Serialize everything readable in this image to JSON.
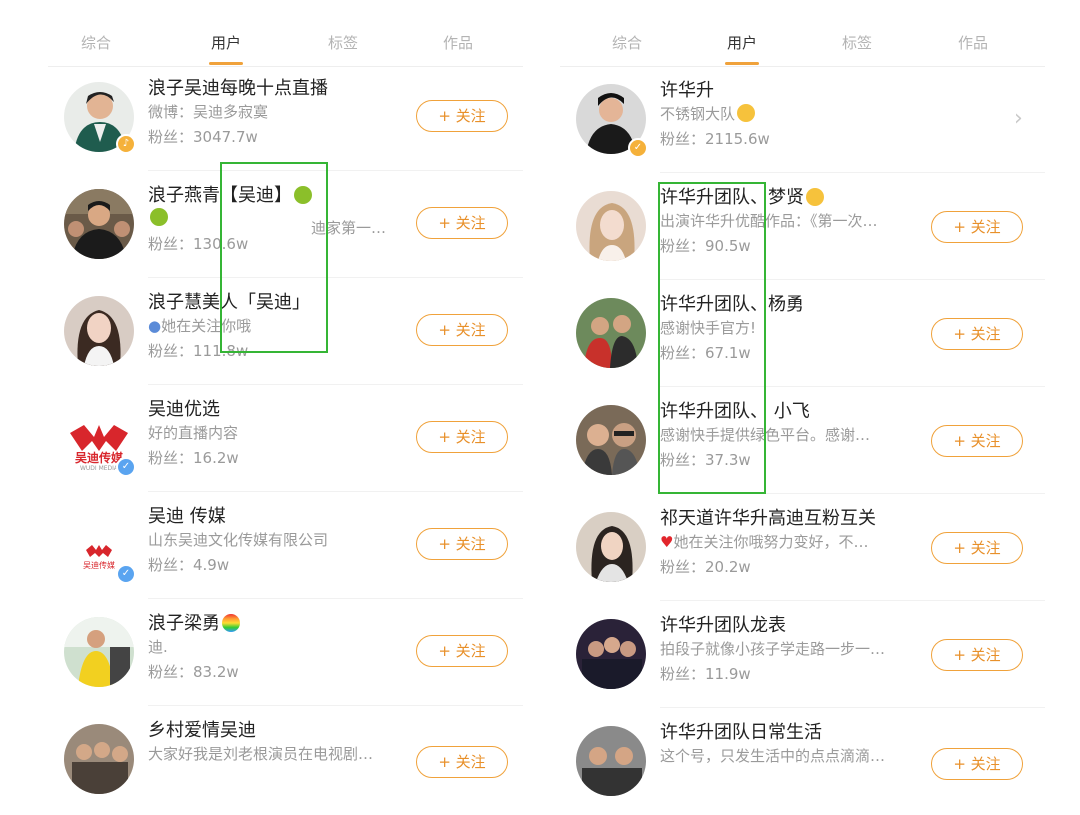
{
  "left": {
    "tabs": [
      "综合",
      "用户",
      "标签",
      "作品"
    ],
    "active_tab": 1,
    "users": [
      {
        "name": "浪子吴迪每晚十点直播",
        "sub": "微博：吴迪多寂寞",
        "fans": "粉丝：3047.7w",
        "follow": "+ 关注",
        "verified": true
      },
      {
        "name": "浪子燕青【吴迪】",
        "name2": "",
        "sub": "迪家第一…",
        "fans": "粉丝：130.6w",
        "follow": "+ 关注",
        "verified": false
      },
      {
        "name": "浪子慧美人「吴迪」",
        "sub": "她在关注你哦",
        "fans": "粉丝：111.8w",
        "follow": "+ 关注",
        "verified": false
      },
      {
        "name": "吴迪优选",
        "sub": "好的直播内容",
        "fans": "粉丝：16.2w",
        "follow": "+ 关注",
        "verified": true,
        "logo_text": "吴迪传媒",
        "logo_sub": "WUDI MEDIA"
      },
      {
        "name": "吴迪 传媒",
        "sub": "山东吴迪文化传媒有限公司",
        "fans": "粉丝：4.9w",
        "follow": "+ 关注",
        "verified": true,
        "logo_text": "吴迪传媒"
      },
      {
        "name": "浪子梁勇",
        "sub": "迪.",
        "fans": "粉丝：83.2w",
        "follow": "+ 关注",
        "verified": false
      },
      {
        "name": "乡村爱情吴迪",
        "sub": "大家好我是刘老根演员在电视剧…",
        "fans": "",
        "follow": "+ 关注",
        "verified": false
      }
    ]
  },
  "right": {
    "tabs": [
      "综合",
      "用户",
      "标签",
      "作品"
    ],
    "active_tab": 1,
    "users": [
      {
        "name": "许华升",
        "sub": "不锈钢大队",
        "fans": "粉丝：2115.6w",
        "follow": "",
        "verified": true
      },
      {
        "name": "许华升团队、梦贤",
        "sub": "出演许华升优酷作品：《第一次…",
        "fans": "粉丝：90.5w",
        "follow": "+ 关注"
      },
      {
        "name": "许华升团队、杨勇",
        "sub": "感谢快手官方!",
        "fans": "粉丝：67.1w",
        "follow": "+ 关注"
      },
      {
        "name": "许华升团队、 小飞",
        "sub": "感谢快手提供绿色平台。感谢…",
        "fans": "粉丝：37.3w",
        "follow": "+ 关注"
      },
      {
        "name": "祁天道许华升高迪互粉互关",
        "sub": "她在关注你哦努力变好，不…",
        "fans": "粉丝：20.2w",
        "follow": "+ 关注"
      },
      {
        "name": "许华升团队龙表",
        "sub": "拍段子就像小孩子学走路一步一…",
        "fans": "粉丝：11.9w",
        "follow": "+ 关注"
      },
      {
        "name": "许华升团队日常生活",
        "sub": "这个号，只发生活中的点点滴滴…",
        "fans": "",
        "follow": "+ 关注"
      }
    ]
  },
  "colors": {
    "accent": "#f0a23b",
    "highlight": "#35b535",
    "verified": "#5aa4f0"
  }
}
